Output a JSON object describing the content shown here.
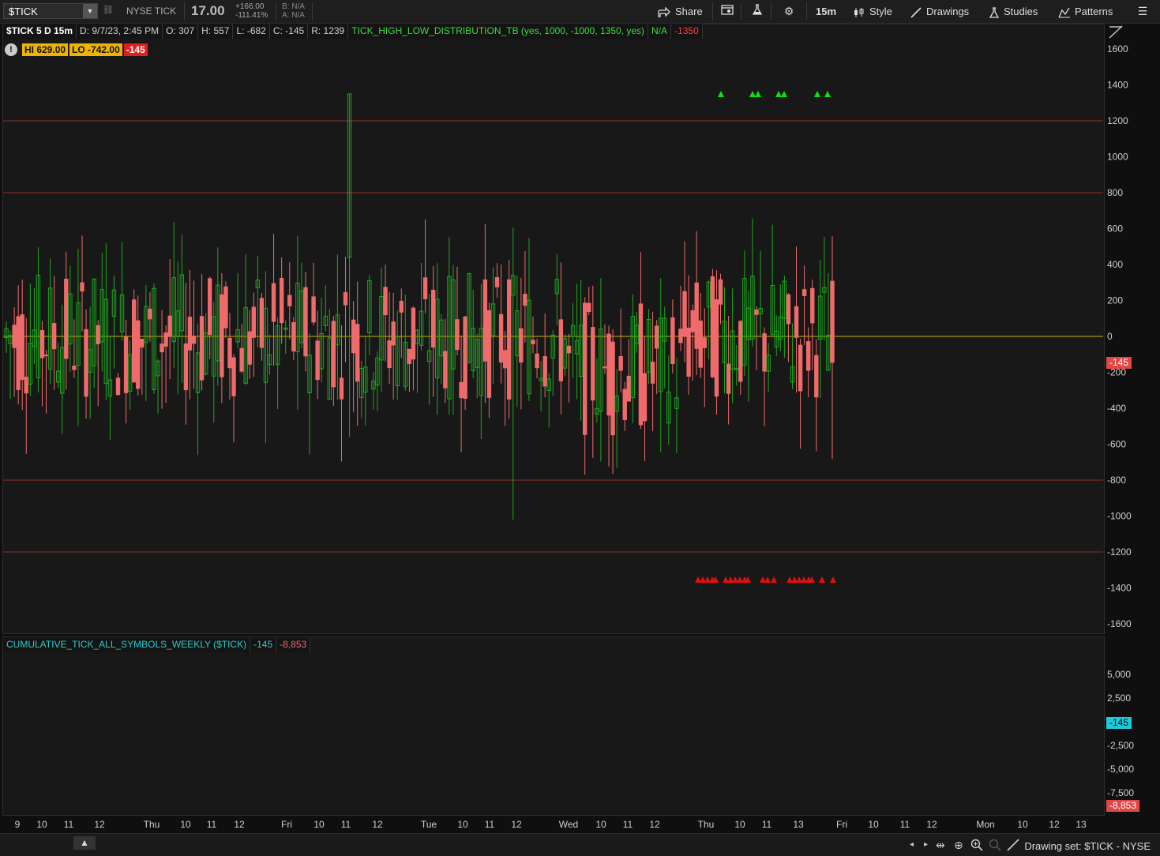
{
  "toolbar": {
    "symbol": "$TICK",
    "description": "NYSE TICK",
    "last": "17.00",
    "change": "+166.00",
    "change_pct": "-111.41%",
    "bid": "B: N/A",
    "ask": "A: N/A",
    "share_label": "Share",
    "timeframe": "15m",
    "style_label": "Style",
    "drawings_label": "Drawings",
    "studies_label": "Studies",
    "patterns_label": "Patterns"
  },
  "info": {
    "title": "$TICK 5 D 15m",
    "date": "D: 9/7/23, 2:45 PM",
    "open": "O: 307",
    "high": "H: 557",
    "low": "L: -682",
    "close": "C: -145",
    "range": "R: 1239",
    "study": "TICK_HIGH_LOW_DISTRIBUTION_TB (yes, 1000, -1000, 1350, yes)",
    "study_val1": "N/A",
    "study_val2": "-1350"
  },
  "hilo": {
    "alert": "!",
    "hi": "HI 629.00",
    "lo": "LO -742.00",
    "current": "-145"
  },
  "lower": {
    "title": "CUMULATIVE_TICK_ALL_SYMBOLS_WEEKLY ($TICK)",
    "val1": "-145",
    "val2": "-8,853"
  },
  "status": {
    "drawing_set": "Drawing set: $TICK - NYSE"
  },
  "colors": {
    "up": "#1fa71f",
    "down": "#ef6b6b",
    "zero_line": "#c8b400",
    "threshold": "#8b2f2f",
    "green_marker": "#11dd11",
    "red_marker": "#e01010",
    "cyan": "#2ec9c9"
  },
  "chart_data": [
    {
      "type": "candlestick",
      "title": "$TICK 5 D 15m",
      "ylim": [
        -1700,
        1700
      ],
      "yticks": [
        1600,
        1400,
        1200,
        1000,
        800,
        600,
        400,
        200,
        0,
        -200,
        -400,
        -600,
        -800,
        -1000,
        -1200,
        -1400,
        -1600
      ],
      "horizontal_lines": [
        1200,
        800,
        0,
        -800,
        -1200
      ],
      "price_label": "-145",
      "xticks": [
        "9",
        "10",
        "11",
        "12",
        "Thu",
        "10",
        "11",
        "12",
        "Fri",
        "10",
        "11",
        "12",
        "Tue",
        "10",
        "11",
        "12",
        "Wed",
        "10",
        "11",
        "12",
        "Thu",
        "10",
        "11",
        "13",
        "Fri",
        "10",
        "11",
        "12",
        "Mon",
        "10",
        "12",
        "13"
      ],
      "candles_summary": {
        "count": 208,
        "high": 1350,
        "low": -1020,
        "last_close": -145
      },
      "green_markers_count": 7,
      "red_markers_count": 22
    },
    {
      "type": "bar",
      "title": "CUMULATIVE_TICK_ALL_SYMBOLS_WEEKLY ($TICK)",
      "ylim": [
        -9000,
        7000
      ],
      "yticks": [
        5000,
        2500,
        -2500,
        -5000,
        -7500
      ],
      "ytick_labels": [
        "5,000",
        "2,500",
        "-2,500",
        "-5,000",
        "-7,500"
      ],
      "price_labels": [
        "-145",
        "-8,853"
      ],
      "last_value": -8853
    }
  ]
}
